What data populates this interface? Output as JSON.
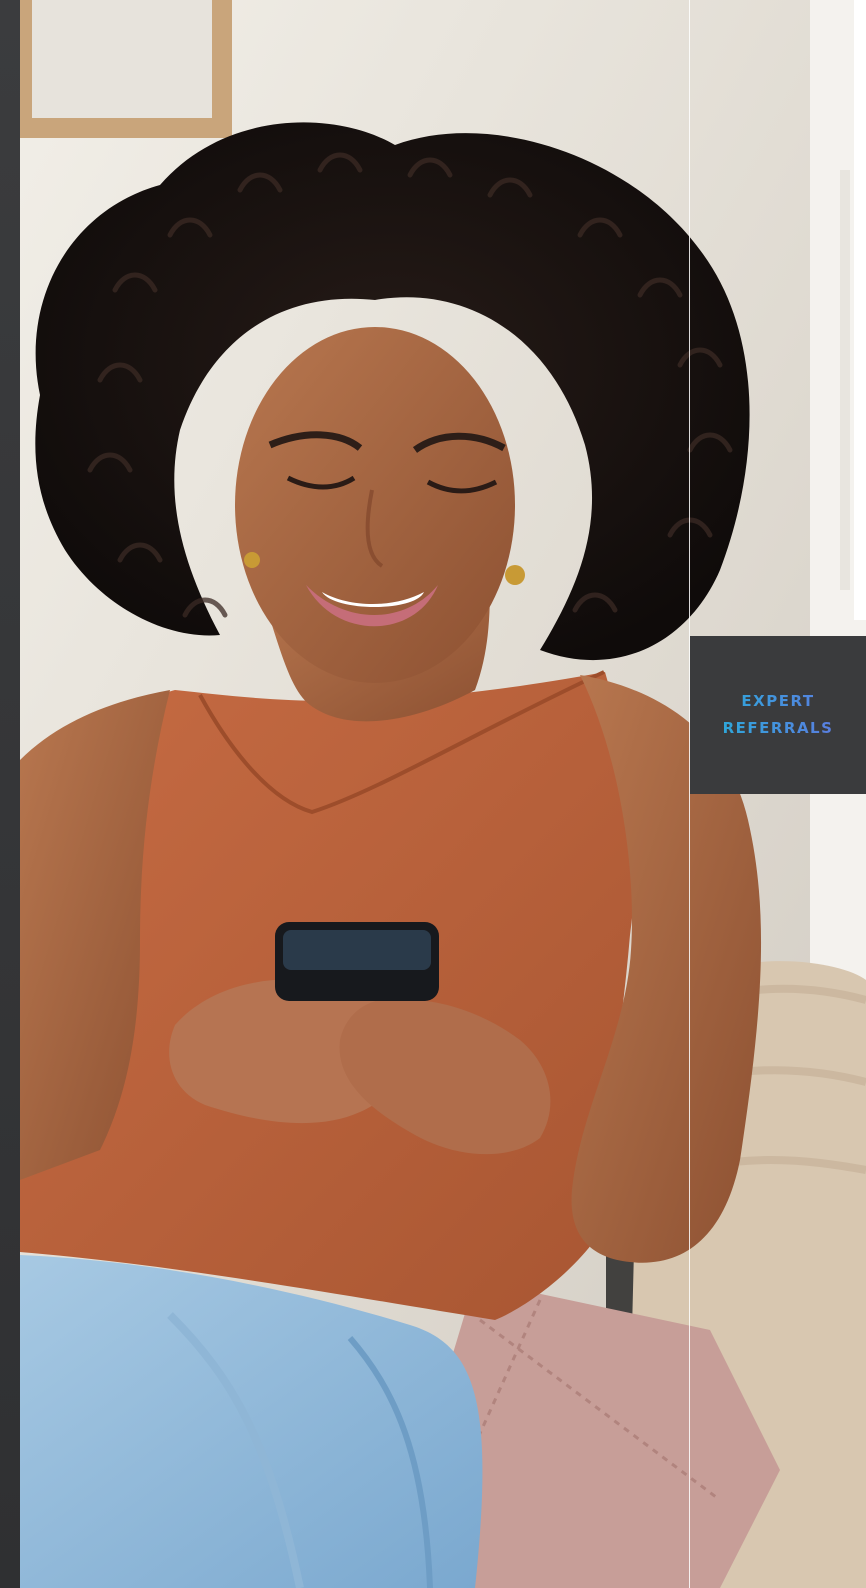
{
  "card": {
    "line1": "EXPERT",
    "line2": "REFERRALS",
    "accent_start": "#2fa6da",
    "accent_end": "#5a7ee0",
    "background": "#3a3b3d"
  },
  "image": {
    "alt": ""
  },
  "colors": {
    "rail": "#3b3c3e",
    "wall": "#dcd8d1",
    "top": "#c86f48",
    "jeans": "#9cc3df",
    "pillow": "#c79e98",
    "throw": "#d8c7b0"
  }
}
